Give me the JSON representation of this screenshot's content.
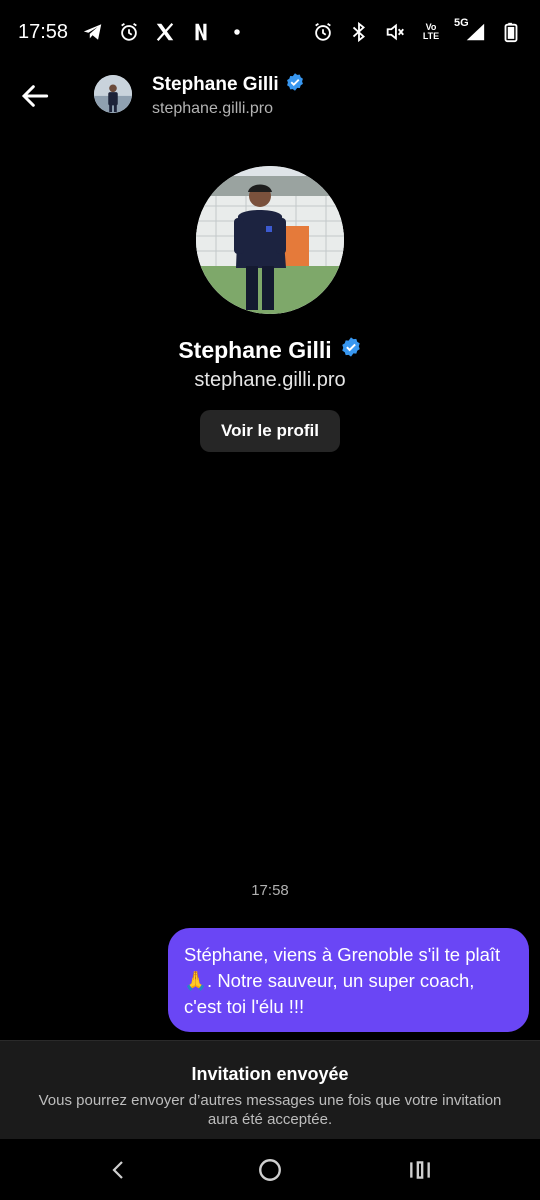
{
  "status_bar": {
    "time": "17:58",
    "left_icons": [
      "telegram-icon",
      "alarm-icon",
      "x-logo-icon",
      "netflix-icon",
      "dot-icon"
    ],
    "right_icons": [
      "alarm-icon",
      "bluetooth-icon",
      "mute-icon",
      "volte-icon",
      "5g-signal-icon",
      "battery-icon"
    ],
    "volte_top": "Vo",
    "volte_bottom": "LTE",
    "network": "5G"
  },
  "header": {
    "name": "Stephane Gilli",
    "handle": "stephane.gilli.pro",
    "verified": true
  },
  "profile": {
    "name": "Stephane Gilli",
    "handle": "stephane.gilli.pro",
    "view_profile_label": "Voir le profil"
  },
  "conversation": {
    "timestamp": "17:58",
    "messages": [
      {
        "from": "me",
        "text": "Stéphane, viens à Grenoble s'il te plaît 🙏. Notre sauveur, un super coach, c'est toi l'élu !!!"
      }
    ]
  },
  "invitation": {
    "title": "Invitation envoyée",
    "description": "Vous pourrez envoyer d’autres messages une fois que votre invitation aura été acceptée."
  },
  "colors": {
    "background": "#000000",
    "bubble": "#6a46f5",
    "verified": "#3897f0",
    "button_bg": "#262626",
    "panel_bg": "#1b1b1b"
  }
}
